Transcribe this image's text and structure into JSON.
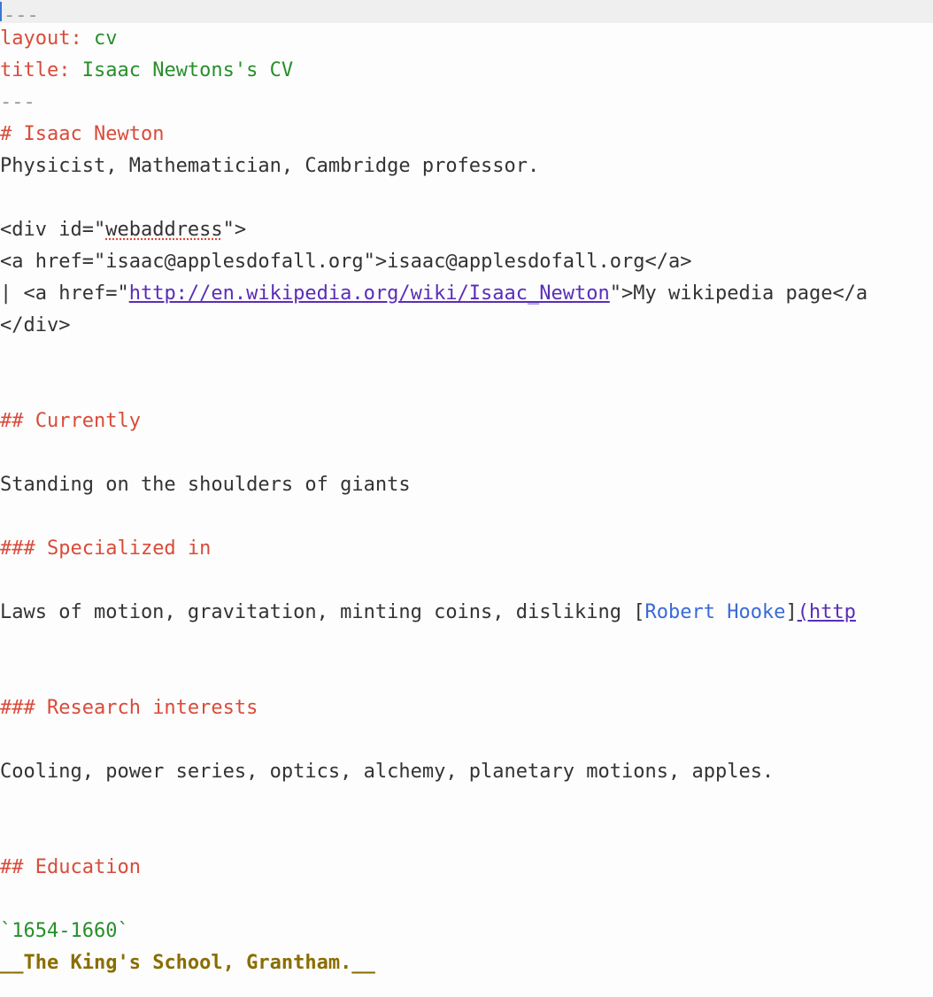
{
  "topbar": {},
  "lines": {
    "hr1": "---",
    "fm_layout_key": "layout:",
    "fm_layout_val": " cv",
    "fm_title_key": "title:",
    "fm_title_val": " Isaac Newtons's CV",
    "hr2": "---",
    "h1_hash": "# ",
    "h1_text": "Isaac Newton",
    "subtitle": "Physicist, Mathematician, Cambridge professor.",
    "div_open_a": "<div id=\"",
    "div_open_id": "webaddress",
    "div_open_b": "\">",
    "a1_a": "<a href=\"",
    "a1_href": "isaac@applesdofall.org",
    "a1_b": "\">",
    "a1_text": "isaac@applesdofall.org",
    "a1_c": "</a>",
    "a2_pre": "| <a href=\"",
    "a2_href": "http://en.wikipedia.org/wiki/Isaac_Newton",
    "a2_b": "\">",
    "a2_text": "My wikipedia page",
    "a2_c": "</a",
    "div_close": "</div>",
    "h2a_hash": "## ",
    "h2a_text": "Currently",
    "currently_body": "Standing on the shoulders of giants",
    "h3a_hash": "### ",
    "h3a_text": "Specialized in",
    "spec_body_a": "Laws of motion, gravitation, minting coins, disliking [",
    "spec_linktext": "Robert Hooke",
    "spec_body_b": "]",
    "spec_linkurl": "(http",
    "h3b_hash": "### ",
    "h3b_text": "Research interests",
    "research_body": "Cooling, power series, optics, alchemy, planetary motions, apples.",
    "h2b_hash": "## ",
    "h2b_text": "Education",
    "edu_date": "`1654-1660`",
    "edu_bold_a": "__",
    "edu_bold_text": "The King's School, Grantham.",
    "edu_bold_b": "__"
  }
}
